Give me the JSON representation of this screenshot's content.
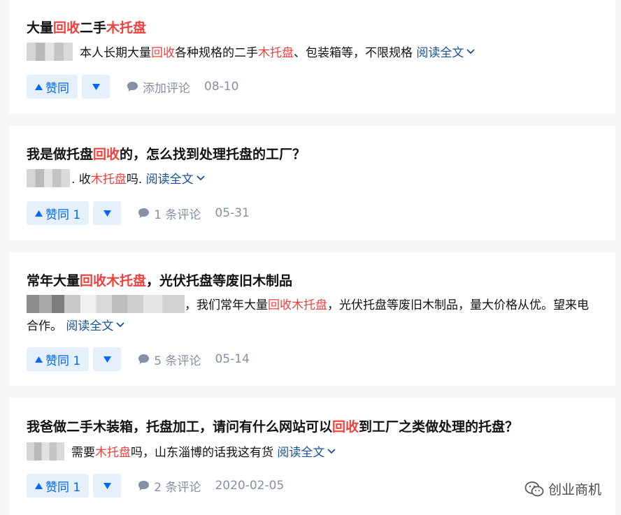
{
  "cards": [
    {
      "title": [
        {
          "t": "大量",
          "hl": false
        },
        {
          "t": "回收",
          "hl": true
        },
        {
          "t": "二手",
          "hl": false
        },
        {
          "t": "木托盘",
          "hl": true
        }
      ],
      "excerpt": [
        {
          "t": "本人长期大量",
          "hl": false
        },
        {
          "t": "回收",
          "hl": true
        },
        {
          "t": "各种规格的二手",
          "hl": false
        },
        {
          "t": "木托盘",
          "hl": true
        },
        {
          "t": "、包装箱等，不限规格",
          "hl": false
        }
      ],
      "read_more": "阅读全文",
      "vote_label": "赞同",
      "comment_label": "添加评论",
      "date": "08-10"
    },
    {
      "title": [
        {
          "t": "我是做托盘",
          "hl": false
        },
        {
          "t": "回收",
          "hl": true
        },
        {
          "t": "的，怎么找到处理托盘的工厂？",
          "hl": false
        }
      ],
      "excerpt": [
        {
          "t": ". 收",
          "hl": false
        },
        {
          "t": "木托盘",
          "hl": true
        },
        {
          "t": "吗.",
          "hl": false
        }
      ],
      "read_more": "阅读全文",
      "vote_label": "赞同 1",
      "comment_label": "1 条评论",
      "date": "05-31"
    },
    {
      "title": [
        {
          "t": "常年大量",
          "hl": false
        },
        {
          "t": "回收木托盘",
          "hl": true
        },
        {
          "t": "，光伏托盘等废旧木制品",
          "hl": false
        }
      ],
      "excerpt": [
        {
          "t": "，我们常年大量",
          "hl": false
        },
        {
          "t": "回收木托盘",
          "hl": true
        },
        {
          "t": "，光伏托盘等废旧木制品，量大价格从优。望来电合作。",
          "hl": false
        }
      ],
      "read_more": "阅读全文",
      "vote_label": "赞同 1",
      "comment_label": "5 条评论",
      "date": "05-14"
    },
    {
      "title": [
        {
          "t": "我爸做二手木装箱，托盘加工，请问有什么网站可以",
          "hl": false
        },
        {
          "t": "回收",
          "hl": true
        },
        {
          "t": "到工厂之类做处理的托盘？",
          "hl": false
        }
      ],
      "excerpt": [
        {
          "t": "需要",
          "hl": false
        },
        {
          "t": "木托盘",
          "hl": true
        },
        {
          "t": "吗，山东淄博的话我这有货",
          "hl": false
        }
      ],
      "read_more": "阅读全文",
      "vote_label": "赞同 1",
      "comment_label": "2 条评论",
      "date": "2020-02-05"
    }
  ],
  "watermark": "创业商机",
  "icons": {
    "vote_up": "triangle-up-icon",
    "vote_down": "triangle-down-icon",
    "comment": "comment-bubble-icon",
    "read_more": "chevron-down-icon",
    "watermark": "wechat-icon"
  },
  "colors": {
    "highlight": "#f1403c",
    "link": "#175199",
    "vote": "#0066ff",
    "vote_bg": "#e6f0fd",
    "meta": "#8590a6"
  }
}
